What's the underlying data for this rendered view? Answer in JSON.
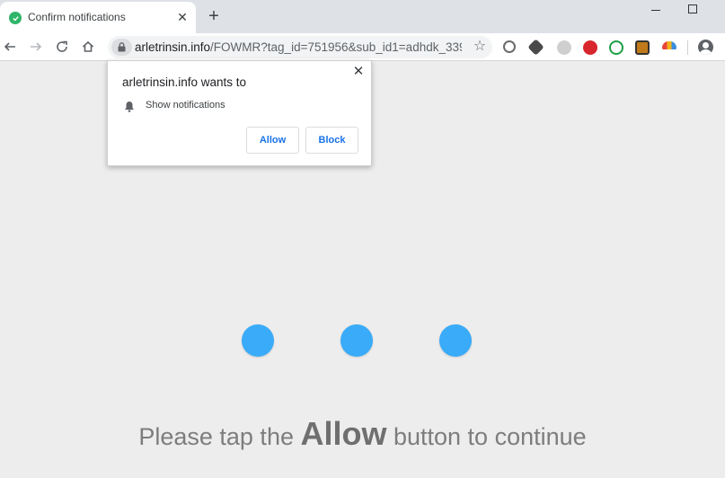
{
  "tab": {
    "title": "Confirm notifications",
    "close": "✕",
    "new_tab": "+"
  },
  "omnibox": {
    "host": "arletrinsin.info",
    "path": "/FOWMR?tag_id=751956&sub_id1=adhdk_339-...",
    "star": "☆"
  },
  "popup": {
    "title": "arletrinsin.info wants to",
    "close": "✕",
    "permission": "Show notifications",
    "allow_label": "Allow",
    "block_label": "Block"
  },
  "page": {
    "message_before": "Please tap the ",
    "message_emphasis": "Allow",
    "message_after": " button to continue"
  },
  "colors": {
    "dot": "#3aabf8",
    "button_text": "#1a73e8",
    "favicon": "#2fb56a",
    "background": "#ededed"
  },
  "icons": [
    "check-icon",
    "close-icon",
    "plus-icon",
    "minimize-icon",
    "maximize-icon",
    "back-icon",
    "forward-icon",
    "reload-icon",
    "home-icon",
    "lock-icon",
    "star-icon",
    "bell-icon",
    "profile-icon"
  ]
}
